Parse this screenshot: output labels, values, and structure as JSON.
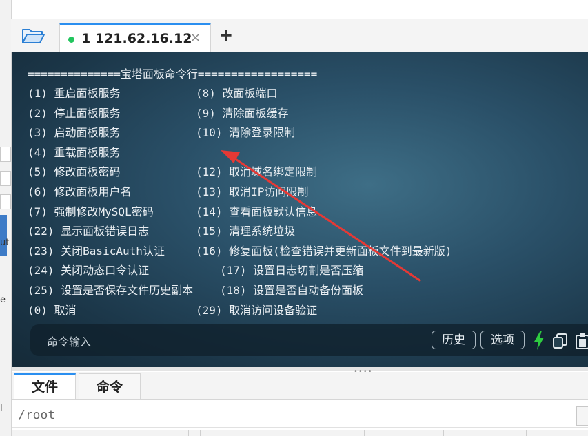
{
  "tab": {
    "label": "1 121.62.16.12",
    "close": "×",
    "add": "+"
  },
  "terminal": {
    "banner": "==============宝塔面板命令行==================",
    "col_left": [
      "(1) 重启面板服务",
      "(2) 停止面板服务",
      "(3) 启动面板服务",
      "(4) 重载面板服务",
      "(5) 修改面板密码",
      "(6) 修改面板用户名",
      "(7) 强制修改MySQL密码",
      "(22) 显示面板错误日志",
      "(23) 关闭BasicAuth认证",
      "(24) 关闭动态口令认证",
      "(25) 设置是否保存文件历史副本",
      "(0) 取消"
    ],
    "col_right": [
      "(8) 改面板端口",
      "(9) 清除面板缓存",
      "(10) 清除登录限制",
      "",
      "(12) 取消域名绑定限制",
      "(13) 取消IP访问限制",
      "(14) 查看面板默认信息",
      "(15) 清理系统垃圾",
      "(16) 修复面板(检查错误并更新面板文件到最新版)",
      "(17) 设置日志切割是否压缩",
      "(18) 设置是否自动备份面板",
      "(29) 取消访问设备验证"
    ]
  },
  "cmdbar": {
    "placeholder": "命令输入",
    "history": "历史",
    "options": "选项"
  },
  "bottom": {
    "tab_files": "文件",
    "tab_commands": "命令",
    "path": "/root"
  },
  "left_fragments": [
    "ut",
    "e",
    "l"
  ],
  "colors": {
    "accent": "#2b8ff0",
    "online": "#22c55e",
    "arrow": "#e53935",
    "bolt": "#2ecc40"
  }
}
